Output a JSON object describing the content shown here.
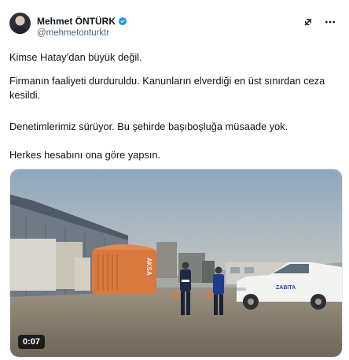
{
  "author": {
    "display_name": "Mehmet ÖNTÜRK",
    "handle": "@mehmetonturktr"
  },
  "tweet": {
    "paragraph_1": "Kimse Hatay’dan büyük değil.",
    "paragraph_2": "Firmanın faaliyeti durduruldu. Kanunların elverdiği en üst sınırdan ceza kesildi.",
    "paragraph_3": "Denetimlerimiz sürüyor. Bu şehirde başıboşluğa müsaade yok.",
    "paragraph_4": "Herkes hesabını ona göre yapsın."
  },
  "media": {
    "duration": "0:07",
    "generator_brand": "AKSA",
    "vehicle_label": "ZABITA"
  },
  "icons": {
    "verified": "verified-badge-icon",
    "grok": "grok-icon",
    "more": "more-icon"
  },
  "colors": {
    "verified_blue": "#1d9bf0",
    "text_primary": "#0f1419",
    "text_secondary": "#536471"
  }
}
